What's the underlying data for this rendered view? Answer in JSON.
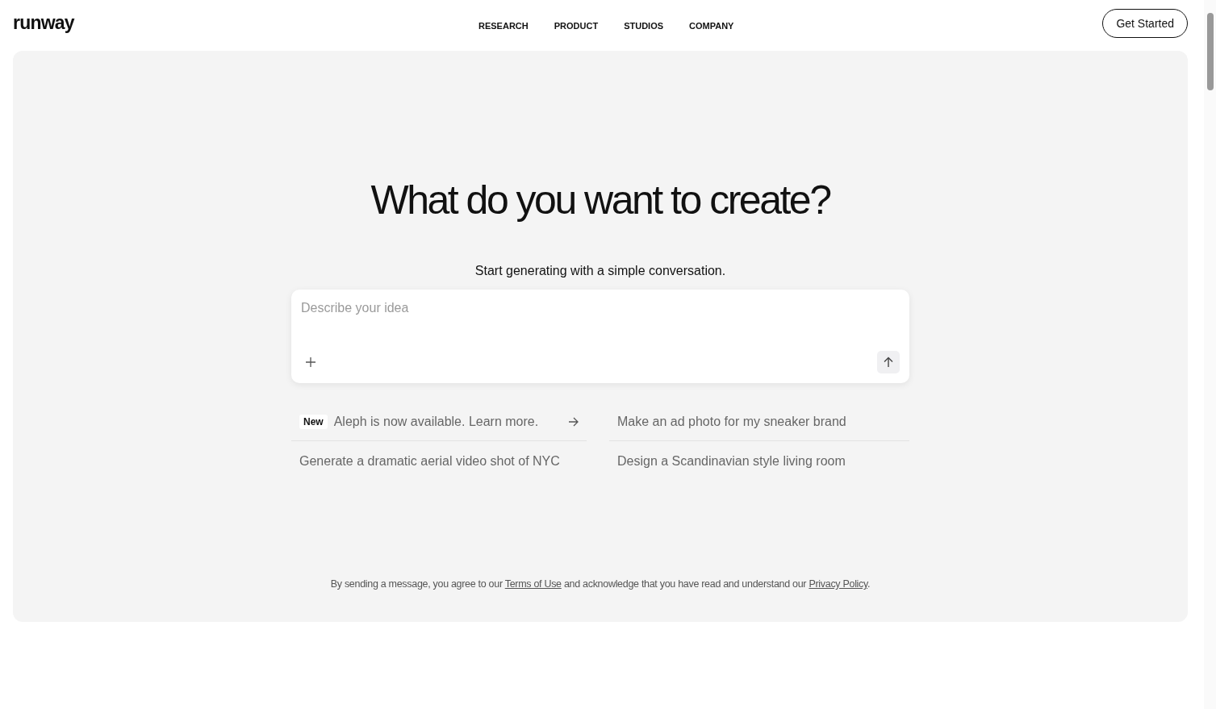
{
  "header": {
    "logo": "runway",
    "nav": [
      {
        "label": "RESEARCH"
      },
      {
        "label": "PRODUCT"
      },
      {
        "label": "STUDIOS"
      },
      {
        "label": "COMPANY"
      }
    ],
    "cta": "Get Started"
  },
  "hero": {
    "title": "What do you want to create?",
    "subtitle": "Start generating with a simple conversation.",
    "prompt": {
      "placeholder": "Describe your idea"
    },
    "suggestions": [
      {
        "kind": "announcement",
        "badge": "New",
        "text": "Aleph is now available. Learn more."
      },
      {
        "kind": "prompt",
        "text": "Make an ad photo for my sneaker brand"
      },
      {
        "kind": "prompt",
        "text": "Generate a dramatic aerial video shot of NYC"
      },
      {
        "kind": "prompt",
        "text": "Design a Scandinavian style living room"
      }
    ],
    "legal": [
      {
        "kind": "text",
        "text": "By sending a message, you agree to our "
      },
      {
        "kind": "link",
        "text": "Terms of Use"
      },
      {
        "kind": "text",
        "text": " and acknowledge that you have read and understand our "
      },
      {
        "kind": "link",
        "text": "Privacy Policy"
      },
      {
        "kind": "text",
        "text": "."
      }
    ]
  }
}
